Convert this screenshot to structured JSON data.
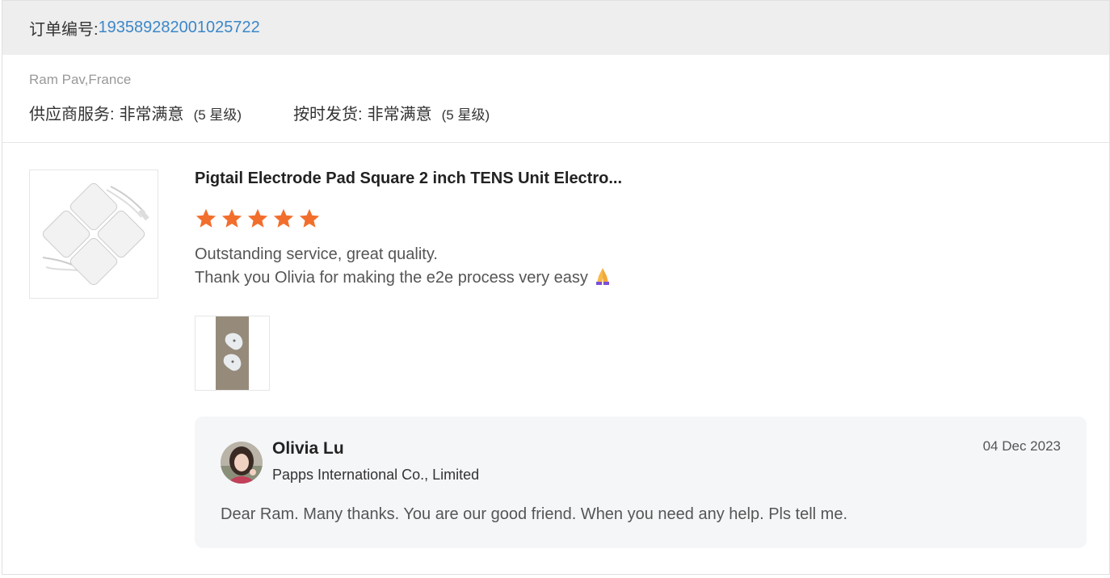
{
  "order": {
    "label": "订单编号:",
    "id": "193589282001025722"
  },
  "buyer": {
    "name_location": "Ram Pav,France"
  },
  "ratings": {
    "supplier_service": {
      "label": "供应商服务:",
      "value": "非常满意",
      "stars_text": "(5 星级)",
      "stars": 5
    },
    "on_time_delivery": {
      "label": "按时发货:",
      "value": "非常满意",
      "stars_text": "(5 星级)",
      "stars": 5
    }
  },
  "product": {
    "title": "Pigtail Electrode Pad Square 2 inch TENS Unit Electro...",
    "rating": 5,
    "star_color": "#f26e2c"
  },
  "review": {
    "line1": "Outstanding service, great quality.",
    "line2": "Thank you Olivia for making the e2e process very easy",
    "emoji": "🙏"
  },
  "reply": {
    "seller_name": "Olivia Lu",
    "company": "Papps International Co., Limited",
    "date": "04 Dec 2023",
    "text": "Dear Ram. Many thanks. You are our good friend. When you need any help. Pls tell me."
  },
  "colors": {
    "accent_link": "#3b87c9",
    "header_bg": "#eeeeee",
    "reply_bg": "#f5f6f8"
  }
}
